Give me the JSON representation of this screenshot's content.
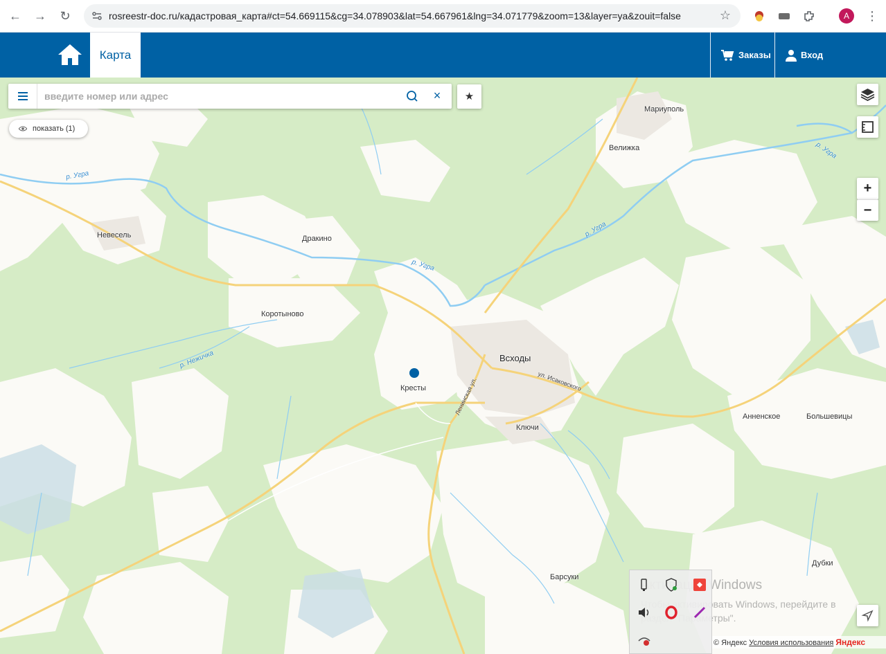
{
  "browser": {
    "url": "rosreestr-doc.ru/кадастровая_карта#ct=54.669115&cg=34.078903&lat=54.667961&lng=34.071779&zoom=13&layer=ya&zouit=false",
    "profile_initial": "A",
    "icons": [
      "back-icon",
      "forward-icon",
      "reload-icon",
      "site-settings-icon",
      "bookmark-star-icon",
      "extensions-icon",
      "menu-icon"
    ]
  },
  "header": {
    "tab_label": "Карта",
    "orders_label": "Заказы",
    "login_label": "Вход",
    "brand_color": "#0061a4"
  },
  "search": {
    "placeholder": "введите номер или адрес"
  },
  "show_button": {
    "label": "показать (1)"
  },
  "zoom": {
    "plus": "+",
    "minus": "−"
  },
  "map": {
    "places": {
      "mariupol": "Мариуполь",
      "velizhka": "Велижка",
      "nevesel": "Невесель",
      "drakino": "Дракино",
      "korotynovo": "Коротыново",
      "vskhody": "Всходы",
      "kresty": "Кресты",
      "klyuchi": "Ключи",
      "annenskoe": "Анненское",
      "bolshevitsy": "Большевицы",
      "barsuki": "Барсуки",
      "dubki": "Дубки"
    },
    "rivers": {
      "ugra_1": "р. Угра",
      "ugra_2": "р. Угра",
      "ugra_3": "р. Угра",
      "ugra_4": "р. Угра",
      "nezhichka": "р. Нежичка"
    },
    "streets": {
      "leninskaya": "Ленинская ул.",
      "isakovskogo": "ул. Исаковского"
    },
    "colors": {
      "forest": "#d6ecc6",
      "field": "#fbfaf6",
      "water": "#9fd4f2",
      "road": "#f5d37a",
      "marker": "#0061a4"
    }
  },
  "footer": {
    "copyright": "© Яндекс",
    "terms": "Условия использования",
    "provider": "Яндекс"
  },
  "windows_watermark": {
    "line1": "Активация Windows",
    "line2": "Чтобы активировать Windows, перейдите в",
    "line3": "раздел \"Параметры\"."
  }
}
